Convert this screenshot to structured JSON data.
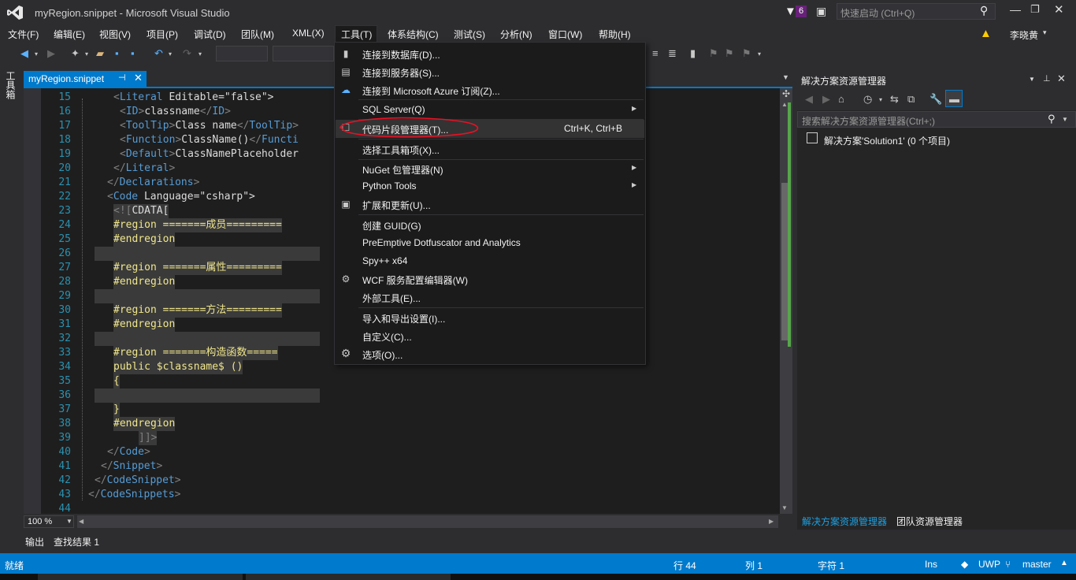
{
  "window": {
    "title": "myRegion.snippet - Microsoft Visual Studio",
    "notifications_count": "6",
    "quick_launch_placeholder": "快速启动 (Ctrl+Q)",
    "user_name": "李晓黄"
  },
  "menus": [
    "文件(F)",
    "编辑(E)",
    "视图(V)",
    "项目(P)",
    "调试(D)",
    "团队(M)",
    "XML(X)",
    "工具(T)",
    "体系结构(C)",
    "测试(S)",
    "分析(N)",
    "窗口(W)",
    "帮助(H)"
  ],
  "toolbox_label": "工具箱",
  "document_tab": {
    "name": "myRegion.snippet"
  },
  "editor": {
    "zoom": "100 %",
    "lines": [
      {
        "n": "15",
        "t": "<Literal Editable=\"false\">"
      },
      {
        "n": "16",
        "t": "<ID>classname</ID>"
      },
      {
        "n": "17",
        "t": "<ToolTip>Class name</ToolTip>"
      },
      {
        "n": "18",
        "t": "<Function>ClassName()</Functi"
      },
      {
        "n": "19",
        "t": "<Default>ClassNamePlaceholder"
      },
      {
        "n": "20",
        "t": "</Literal>"
      },
      {
        "n": "21",
        "t": "</Declarations>"
      },
      {
        "n": "22",
        "t": "<Code Language=\"csharp\">"
      },
      {
        "n": "23",
        "t": "<![CDATA["
      },
      {
        "n": "24",
        "t": "#region =======成员========="
      },
      {
        "n": "25",
        "t": "#endregion"
      },
      {
        "n": "26",
        "t": ""
      },
      {
        "n": "27",
        "t": "#region =======属性========="
      },
      {
        "n": "28",
        "t": "#endregion"
      },
      {
        "n": "29",
        "t": ""
      },
      {
        "n": "30",
        "t": "#region =======方法========="
      },
      {
        "n": "31",
        "t": "#endregion"
      },
      {
        "n": "32",
        "t": ""
      },
      {
        "n": "33",
        "t": "#region =======构造函数====="
      },
      {
        "n": "34",
        "t": "public $classname$ ()"
      },
      {
        "n": "35",
        "t": "{"
      },
      {
        "n": "36",
        "t": ""
      },
      {
        "n": "37",
        "t": "}"
      },
      {
        "n": "38",
        "t": "#endregion"
      },
      {
        "n": "39",
        "t": "]]>"
      },
      {
        "n": "40",
        "t": "</Code>"
      },
      {
        "n": "41",
        "t": "</Snippet>"
      },
      {
        "n": "42",
        "t": "</CodeSnippet>"
      },
      {
        "n": "43",
        "t": "</CodeSnippets>"
      },
      {
        "n": "44",
        "t": ""
      }
    ]
  },
  "tools_menu": {
    "items": [
      {
        "label": "连接到数据库(D)...",
        "shortcut": "",
        "submenu": false,
        "icon": "database-icon"
      },
      {
        "label": "连接到服务器(S)...",
        "shortcut": "",
        "submenu": false,
        "icon": "server-icon"
      },
      {
        "label": "连接到 Microsoft Azure 订阅(Z)...",
        "shortcut": "",
        "submenu": false,
        "icon": "cloud-icon"
      },
      {
        "label": "SQL Server(Q)",
        "shortcut": "",
        "submenu": true,
        "icon": ""
      },
      {
        "label": "代码片段管理器(T)...",
        "shortcut": "Ctrl+K, Ctrl+B",
        "submenu": false,
        "icon": "checkbox-icon"
      },
      {
        "label": "选择工具箱项(X)...",
        "shortcut": "",
        "submenu": false,
        "icon": ""
      },
      {
        "label": "NuGet 包管理器(N)",
        "shortcut": "",
        "submenu": true,
        "icon": ""
      },
      {
        "label": "Python Tools",
        "shortcut": "",
        "submenu": true,
        "icon": ""
      },
      {
        "label": "扩展和更新(U)...",
        "shortcut": "",
        "submenu": false,
        "icon": "extensions-icon"
      },
      {
        "label": "创建 GUID(G)",
        "shortcut": "",
        "submenu": false,
        "icon": ""
      },
      {
        "label": "PreEmptive Dotfuscator and Analytics",
        "shortcut": "",
        "submenu": false,
        "icon": ""
      },
      {
        "label": "Spy++ x64",
        "shortcut": "",
        "submenu": false,
        "icon": ""
      },
      {
        "label": "WCF 服务配置编辑器(W)",
        "shortcut": "",
        "submenu": false,
        "icon": "gears-icon"
      },
      {
        "label": "外部工具(E)...",
        "shortcut": "",
        "submenu": false,
        "icon": ""
      },
      {
        "label": "导入和导出设置(I)...",
        "shortcut": "",
        "submenu": false,
        "icon": ""
      },
      {
        "label": "自定义(C)...",
        "shortcut": "",
        "submenu": false,
        "icon": ""
      },
      {
        "label": "选项(O)...",
        "shortcut": "",
        "submenu": false,
        "icon": "gear-icon"
      }
    ]
  },
  "solution_explorer": {
    "title": "解决方案资源管理器",
    "search_placeholder": "搜索解决方案资源管理器(Ctrl+;)",
    "tree_item": "解决方案'Solution1' (0 个项目)",
    "tab_active": "解决方案资源管理器",
    "tab_other": "团队资源管理器"
  },
  "bottom_tabs": [
    "输出",
    "查找结果 1"
  ],
  "status": {
    "ready": "就绪",
    "line": "行 44",
    "col": "列 1",
    "char": "字符 1",
    "mode": "Ins",
    "platform": "UWP",
    "branch": "master"
  },
  "colors": {
    "accent": "#007acc",
    "highlight_ellipse": "#e81123"
  }
}
